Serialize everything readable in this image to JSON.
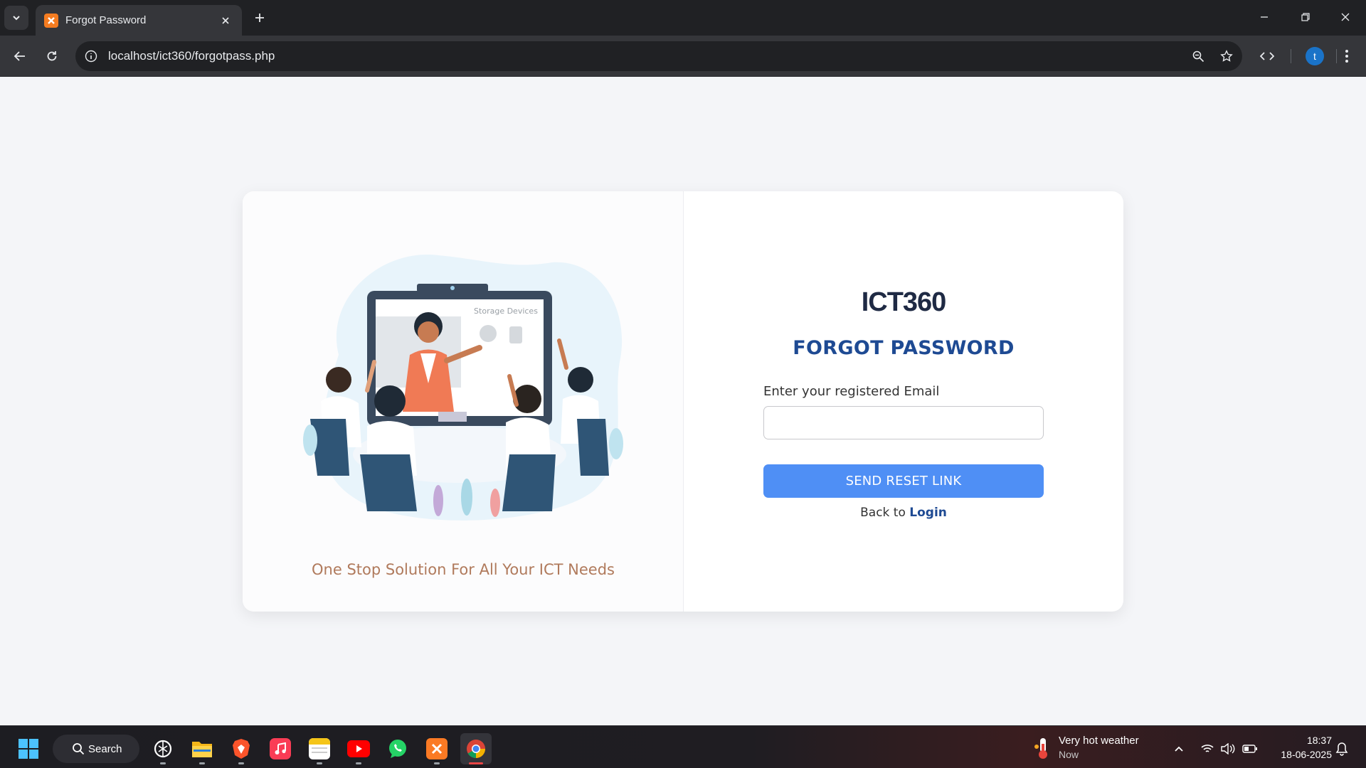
{
  "browser": {
    "tab": {
      "title": "Forgot Password"
    },
    "address_bar": {
      "url": "localhost/ict360/forgotpass.php"
    },
    "profile_initial": "t"
  },
  "page": {
    "logo_text": "ICT360",
    "title": "FORGOT PASSWORD",
    "email_label": "Enter your registered Email",
    "email_value": "",
    "email_placeholder": "",
    "send_button": "SEND RESET LINK",
    "back_text": "Back to",
    "login_link": "Login",
    "tagline": "One Stop Solution For All Your ICT Needs",
    "illustration_screen_text": "Storage Devices",
    "accent_color": "#1e4a93",
    "button_color": "#4f8ff5"
  },
  "taskbar": {
    "search_label": "Search",
    "apps": [
      "chatgpt-icon",
      "file-explorer-icon",
      "brave-icon",
      "music-icon",
      "notes-icon",
      "youtube-icon",
      "whatsapp-icon",
      "xampp-icon",
      "chrome-icon"
    ],
    "weather": {
      "title": "Very hot weather",
      "subtitle": "Now"
    },
    "clock": {
      "time": "18:37",
      "date": "18-06-2025"
    }
  }
}
